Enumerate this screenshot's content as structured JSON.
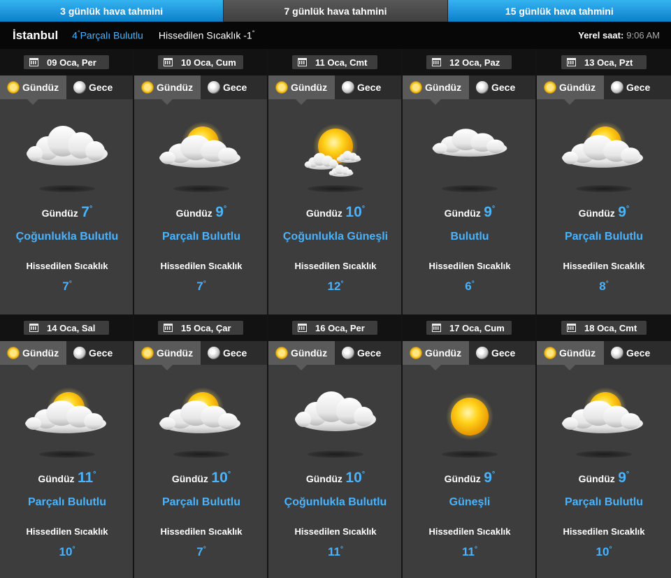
{
  "tabs": [
    {
      "label": "3 günlük hava tahmini",
      "style": "blue"
    },
    {
      "label": "7 günlük hava tahmini",
      "style": "grey"
    },
    {
      "label": "15 günlük hava tahmini",
      "style": "blue"
    }
  ],
  "header": {
    "city": "İstanbul",
    "current_temp": "4",
    "current_condition": "Parçalı Bulutlu",
    "feels_label": "Hissedilen Sıcaklık",
    "feels_value": "-1",
    "degree": "°",
    "local_time_label": "Yerel saat:",
    "local_time_value": "9:06 AM"
  },
  "labels": {
    "day": "Gündüz",
    "night": "Gece",
    "feels": "Hissedilen Sıcaklık",
    "degree": "°"
  },
  "colors": {
    "accent": "#4ab3ff",
    "card": "#3d3d3d",
    "tab_blue": "#1a93de"
  },
  "days": [
    {
      "date": "09 Oca, Per",
      "temp": "7",
      "condition": "Çoğunlukla Bulutlu",
      "feels": "7",
      "icon": "cloudy-icon"
    },
    {
      "date": "10 Oca, Cum",
      "temp": "9",
      "condition": "Parçalı Bulutlu",
      "feels": "7",
      "icon": "partly-cloudy-icon"
    },
    {
      "date": "11 Oca, Cmt",
      "temp": "10",
      "condition": "Çoğunlukla Güneşli",
      "feels": "12",
      "icon": "mostly-sunny-icon"
    },
    {
      "date": "12 Oca, Paz",
      "temp": "9",
      "condition": "Bulutlu",
      "feels": "6",
      "icon": "cloud-icon"
    },
    {
      "date": "13 Oca, Pzt",
      "temp": "9",
      "condition": "Parçalı Bulutlu",
      "feels": "8",
      "icon": "partly-cloudy-icon"
    },
    {
      "date": "14 Oca, Sal",
      "temp": "11",
      "condition": "Parçalı Bulutlu",
      "feels": "10",
      "icon": "partly-cloudy-icon"
    },
    {
      "date": "15 Oca, Çar",
      "temp": "10",
      "condition": "Parçalı Bulutlu",
      "feels": "7",
      "icon": "partly-cloudy-icon"
    },
    {
      "date": "16 Oca, Per",
      "temp": "10",
      "condition": "Çoğunlukla Bulutlu",
      "feels": "11",
      "icon": "cloudy-icon"
    },
    {
      "date": "17 Oca, Cum",
      "temp": "9",
      "condition": "Güneşli",
      "feels": "11",
      "icon": "sun-icon"
    },
    {
      "date": "18 Oca, Cmt",
      "temp": "9",
      "condition": "Parçalı Bulutlu",
      "feels": "10",
      "icon": "partly-cloudy-icon"
    }
  ]
}
